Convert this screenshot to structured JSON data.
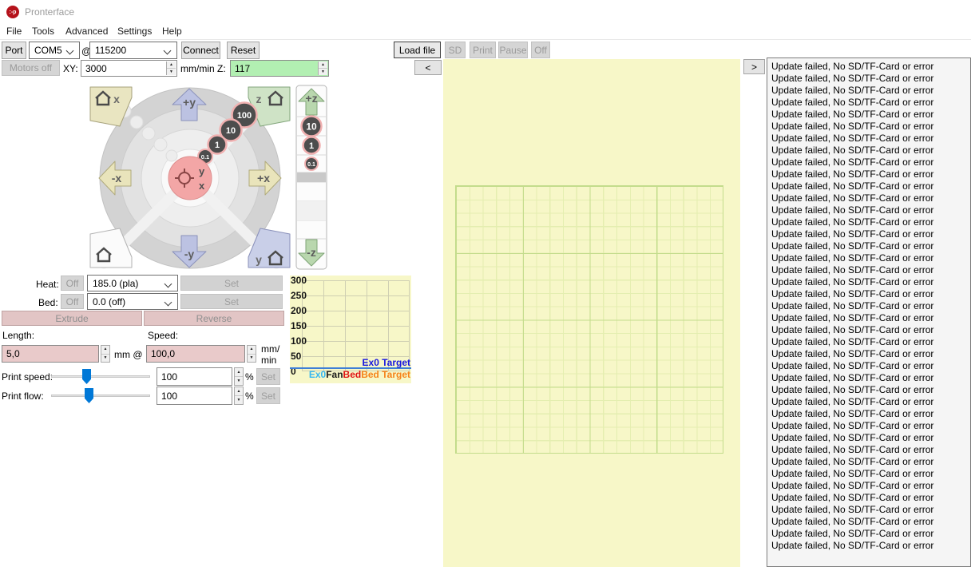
{
  "window": {
    "title": "Pronterface",
    "icon_text": ":-p"
  },
  "menu": {
    "items": [
      "File",
      "Tools",
      "Advanced",
      "Settings",
      "Help"
    ]
  },
  "toolbar": {
    "port": "Port",
    "port_value": "COM5",
    "at": "@",
    "baud_value": "115200",
    "connect": "Connect",
    "reset": "Reset",
    "load_file": "Load file",
    "sd": "SD",
    "print": "Print",
    "pause": "Pause",
    "off": "Off"
  },
  "motion": {
    "motors_off": "Motors off",
    "xy_label": "XY:",
    "xy_feed": "3000",
    "z_label": "mm/min Z:",
    "z_feed": "117"
  },
  "jog": {
    "home_x": "x",
    "home_z": "z",
    "home_y": "y",
    "plus_y": "+y",
    "minus_y": "-y",
    "minus_x": "-x",
    "plus_x": "+x",
    "center_y": "y",
    "center_x": "x",
    "xy_distances": [
      "100",
      "10",
      "1",
      "0.1"
    ],
    "plus_z": "+z",
    "minus_z": "-z",
    "z_distances": [
      "10",
      "1",
      "0.1"
    ]
  },
  "heater": {
    "heat_label": "Heat:",
    "heat_off": "Off",
    "heat_value": "185.0 (pla)",
    "heat_set": "Set",
    "bed_label": "Bed:",
    "bed_off": "Off",
    "bed_value": "0.0 (off)",
    "bed_set": "Set"
  },
  "extruder": {
    "extrude": "Extrude",
    "reverse": "Reverse",
    "length_label": "Length:",
    "length_value": "5,0",
    "length_unit": "mm @",
    "speed_label": "Speed:",
    "speed_value": "100,0",
    "speed_unit_1": "mm/",
    "speed_unit_2": "min"
  },
  "sliders": {
    "print_speed_label": "Print speed:",
    "print_speed_value": "100",
    "print_flow_label": "Print flow:",
    "print_flow_value": "100",
    "percent": "%",
    "set": "Set"
  },
  "chart_data": {
    "type": "line",
    "title": "Temperature graph",
    "xlabel": "",
    "ylabel": "",
    "yticks": [
      300,
      250,
      200,
      150,
      100,
      50,
      0
    ],
    "ylim": [
      0,
      300
    ],
    "grid": true,
    "series": [
      {
        "name": "Ex0 Target",
        "color": "#3f7fd6",
        "values": [
          0,
          0
        ],
        "note": "flat target line at 0"
      }
    ],
    "legend": [
      {
        "label": "Ex0 Target",
        "color": "#1616e0"
      },
      {
        "label": "Ex0",
        "color": "#35b7f0"
      },
      {
        "label": "Fan",
        "color": "#1a1a1a"
      },
      {
        "label": "Bed",
        "color": "#e01414"
      },
      {
        "label": "Bed Target",
        "color": "#f58218"
      }
    ],
    "legend_position": "bottom-right"
  },
  "panel": {
    "collapse_left": "<",
    "collapse_right": ">"
  },
  "log": {
    "line": "Update failed, No SD/TF-Card or error",
    "count": 41
  },
  "colors": {
    "canvas_bg": "#f7f7c8",
    "grid_major": "#c3dc8c",
    "grid_minor": "#e4eeb0",
    "accent_pink": "#e9caca",
    "accent_green": "#b2efb2",
    "slider_thumb": "#0078d7",
    "app_icon_red": "#b5121b"
  }
}
